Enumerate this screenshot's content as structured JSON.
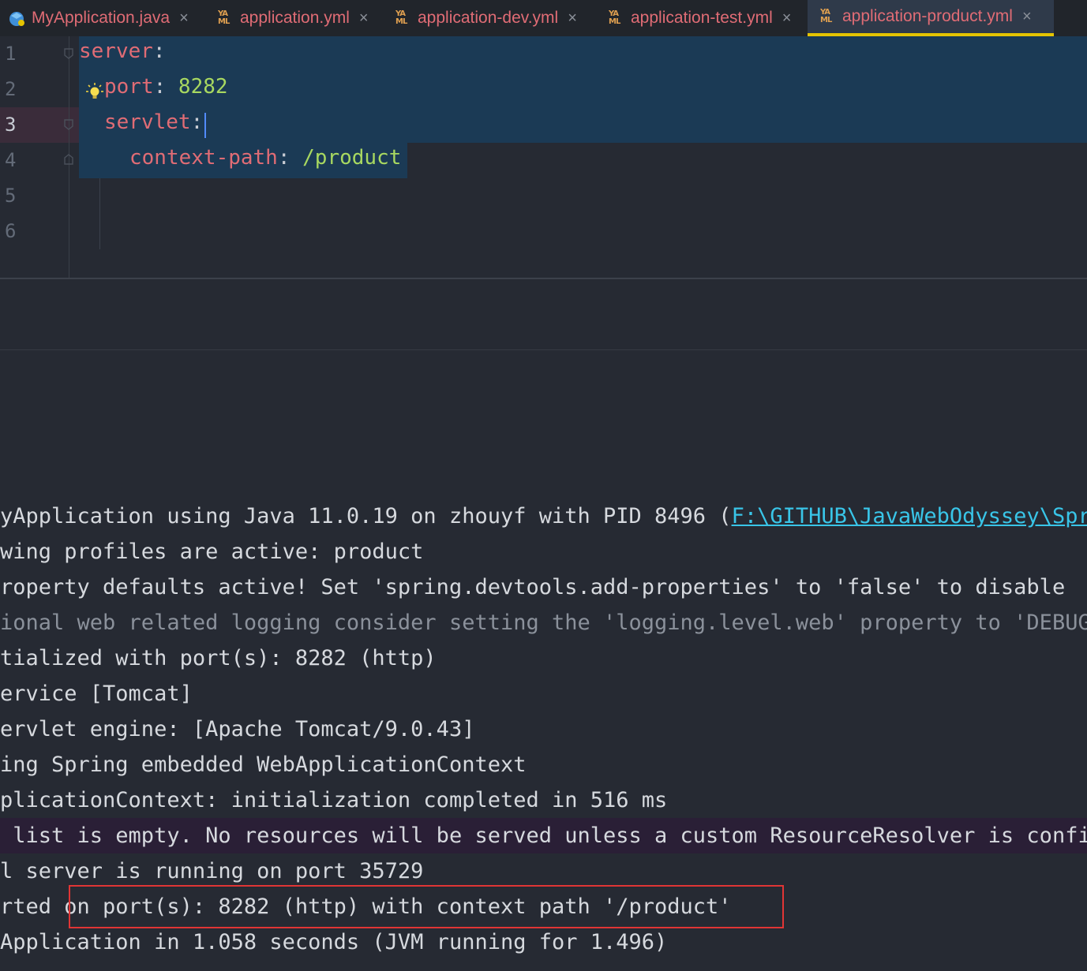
{
  "tabs": [
    {
      "label": "MyApplication.java",
      "icon": "java-class-icon",
      "active": false
    },
    {
      "label": "application.yml",
      "icon": "yaml-file-icon",
      "active": false
    },
    {
      "label": "application-dev.yml",
      "icon": "yaml-file-icon",
      "active": false
    },
    {
      "label": "application-test.yml",
      "icon": "yaml-file-icon",
      "active": false
    },
    {
      "label": "application-product.yml",
      "icon": "yaml-file-icon",
      "active": true
    }
  ],
  "close_glyph": "×",
  "yaml_icon_text": {
    "top": "YA",
    "bottom": "ML"
  },
  "editor": {
    "line_numbers": [
      "1",
      "2",
      "3",
      "4",
      "5",
      "6"
    ],
    "current_line": "3",
    "lines": [
      {
        "key": "server",
        "colon": ":",
        "value": ""
      },
      {
        "key": "port",
        "colon": ":",
        "value": " 8282"
      },
      {
        "key": "servlet",
        "colon": ":",
        "value": ""
      },
      {
        "key": "context-path",
        "colon": ":",
        "value": " /product"
      }
    ]
  },
  "console": {
    "lines": [
      {
        "text_before": "yApplication using Java 11.0.19 on zhouyf with PID 8496 (",
        "link": "F:\\GITHUB\\JavaWebOdyssey\\Spri",
        "style": "normal"
      },
      {
        "text": "wing profiles are active: product",
        "style": "normal"
      },
      {
        "text": "roperty defaults active! Set 'spring.devtools.add-properties' to 'false' to disable",
        "style": "normal"
      },
      {
        "text": "ional web related logging consider setting the 'logging.level.web' property to 'DEBUG'",
        "style": "dim"
      },
      {
        "text": "tialized with port(s): 8282 (http)",
        "style": "normal"
      },
      {
        "text": "ervice [Tomcat]",
        "style": "normal"
      },
      {
        "text": "ervlet engine: [Apache Tomcat/9.0.43]",
        "style": "normal"
      },
      {
        "text": "ing Spring embedded WebApplicationContext",
        "style": "normal"
      },
      {
        "text": "plicationContext: initialization completed in 516 ms",
        "style": "normal"
      },
      {
        "text": " list is empty. No resources will be served unless a custom ResourceResolver is configu",
        "style": "warn"
      },
      {
        "text": "l server is running on port 35729",
        "style": "normal"
      },
      {
        "text": "rted on port(s): 8282 (http) with context path '/product'",
        "style": "normal"
      },
      {
        "text": "Application in 1.058 seconds (JVM running for 1.496)",
        "style": "normal"
      }
    ]
  },
  "colors": {
    "key": "#e06c75",
    "value": "#a8d860",
    "selection": "#1b3a55",
    "tab_underline": "#e5c400",
    "annotation_box": "#e03535"
  }
}
